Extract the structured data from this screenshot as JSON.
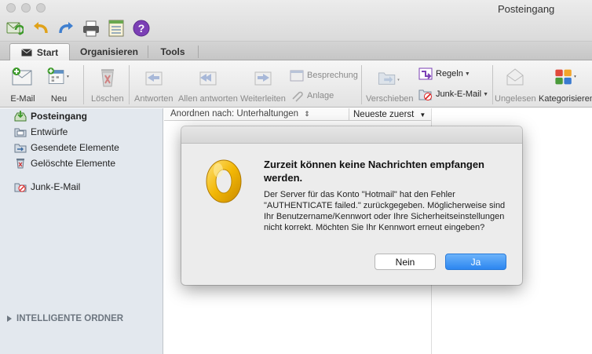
{
  "window": {
    "title": "Posteingang"
  },
  "quick_access": [
    {
      "icon": "send-receive-icon"
    },
    {
      "icon": "undo-icon"
    },
    {
      "icon": "redo-icon"
    },
    {
      "icon": "print-icon"
    },
    {
      "icon": "calendar-icon"
    },
    {
      "icon": "help-icon"
    }
  ],
  "tabs": [
    {
      "label": "Start",
      "active": true
    },
    {
      "label": "Organisieren",
      "active": false
    },
    {
      "label": "Tools",
      "active": false
    }
  ],
  "ribbon": {
    "email": "E-Mail",
    "new": "Neu",
    "delete": "Löschen",
    "reply": "Antworten",
    "reply_all": "Allen antworten",
    "forward": "Weiterleiten",
    "meeting": "Besprechung",
    "attachment": "Anlage",
    "move": "Verschieben",
    "rules": "Regeln",
    "junk": "Junk-E-Mail",
    "unread": "Ungelesen",
    "categorize": "Kategorisieren"
  },
  "sidebar": {
    "folders": [
      {
        "label": "Posteingang",
        "icon": "inbox-icon",
        "selected": true
      },
      {
        "label": "Entwürfe",
        "icon": "drafts-icon",
        "selected": false
      },
      {
        "label": "Gesendete Elemente",
        "icon": "sent-icon",
        "selected": false
      },
      {
        "label": "Gelöschte Elemente",
        "icon": "trash-icon",
        "selected": false
      },
      {
        "label": "Junk-E-Mail",
        "icon": "junk-icon",
        "selected": false
      }
    ],
    "smart_folders": "INTELLIGENTE ORDNER"
  },
  "list": {
    "arrange_by": "Anordnen nach: Unterhaltungen",
    "sort_order": "Neueste zuerst"
  },
  "dialog": {
    "title": "Zurzeit können keine Nachrichten empfangen werden.",
    "message": "Der Server für das Konto \"Hotmail\" hat den Fehler \"AUTHENTICATE failed.\" zurückgegeben. Möglicherweise sind Ihr Benutzername/Kennwort oder Ihre Sicherheitseinstellungen nicht korrekt. Möchten Sie Ihr Kennwort erneut eingeben?",
    "no_label": "Nein",
    "yes_label": "Ja"
  },
  "colors": {
    "accent": "#2c86f0",
    "outlook_gold": "#f2b705",
    "sidebar_bg": "#e3e8ee"
  }
}
